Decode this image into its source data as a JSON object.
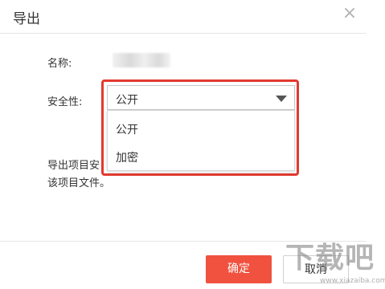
{
  "dialog": {
    "title": "导出",
    "close_icon": "close-icon",
    "close_glyph": "×"
  },
  "form": {
    "name_label": "名称:",
    "security_label": "安全性:",
    "security_selected": "公开",
    "security_options": [
      "公开",
      "加密"
    ]
  },
  "description": {
    "line1": "导出项目安",
    "line2": "该项目文件。"
  },
  "buttons": {
    "confirm": "确定",
    "cancel": "取消"
  },
  "watermark": {
    "text": "下载吧",
    "sub": "www.xiazaiba.com"
  },
  "colors": {
    "accent": "#f0523f",
    "highlight_border": "#e23a2f"
  }
}
